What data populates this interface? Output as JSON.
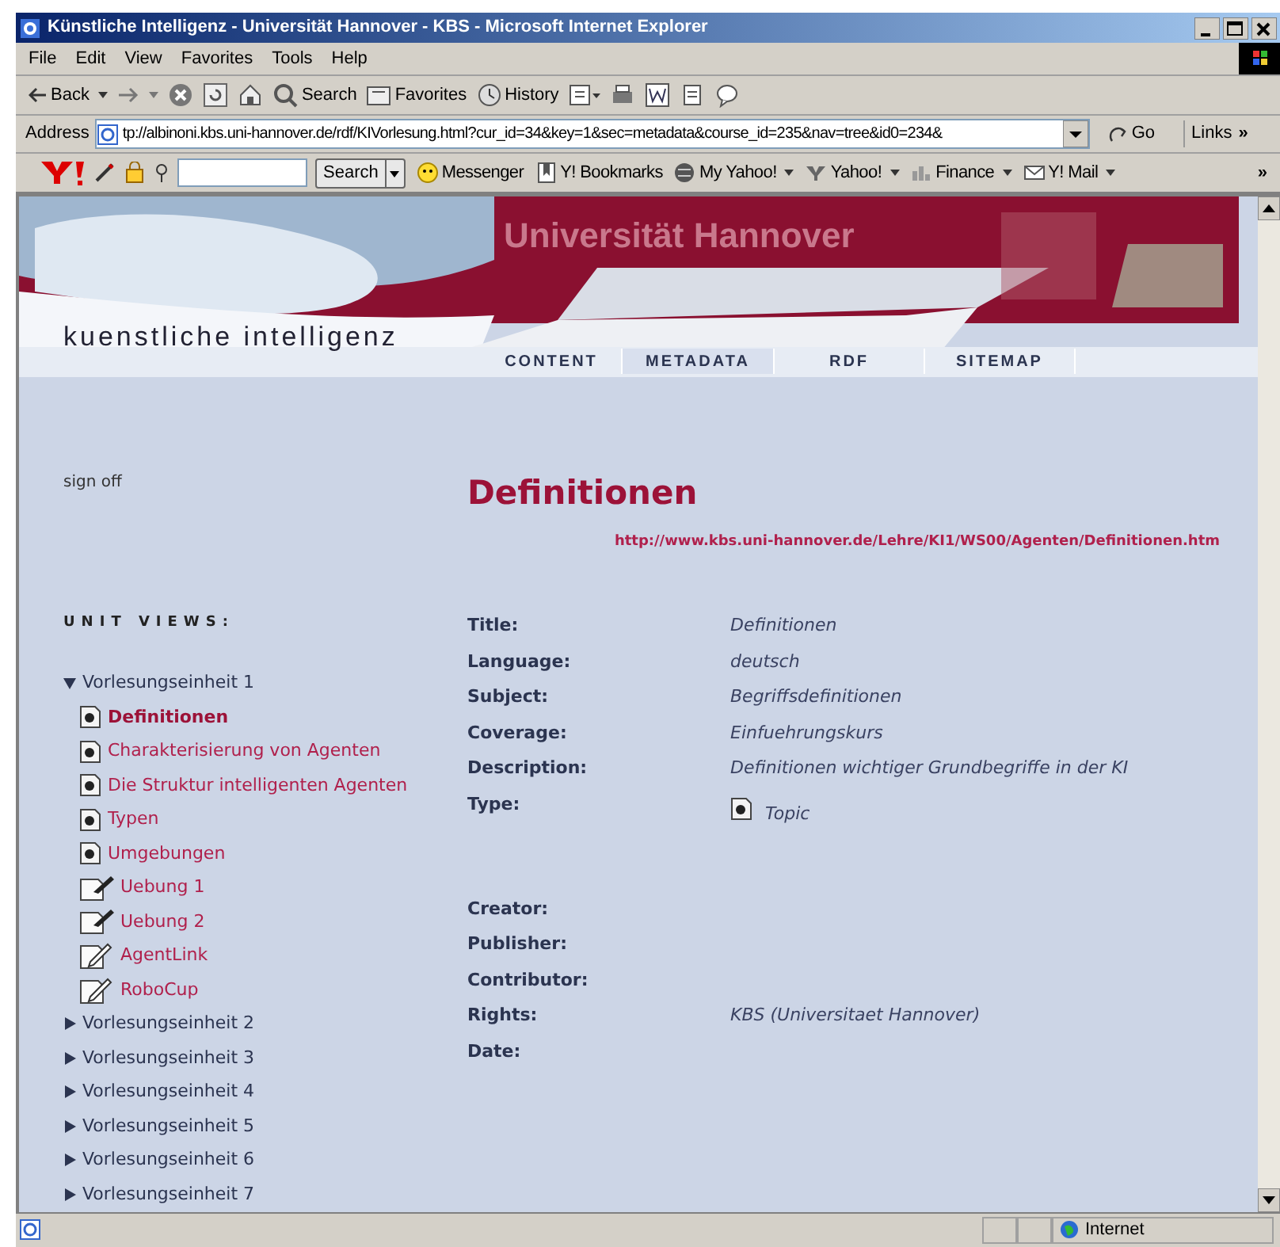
{
  "window": {
    "title": "Künstliche Intelligenz - Universität Hannover - KBS - Microsoft Internet Explorer"
  },
  "menu": [
    "File",
    "Edit",
    "View",
    "Favorites",
    "Tools",
    "Help"
  ],
  "toolbar": {
    "back": "Back",
    "search": "Search",
    "favorites": "Favorites",
    "history": "History"
  },
  "address": {
    "label": "Address",
    "url": "tp://albinoni.kbs.uni-hannover.de/rdf/KIVorlesung.html?cur_id=34&key=1&sec=metadata&course_id=235&nav=tree&id0=234&",
    "go": "Go",
    "links": "Links",
    "links_more": "»"
  },
  "yahoo_bar": {
    "search_button": "Search",
    "items": [
      "Messenger",
      "Y! Bookmarks",
      "My Yahoo!",
      "Yahoo!",
      "Finance",
      "Y! Mail"
    ],
    "more": "»"
  },
  "banner": {
    "university": "Universität Hannover",
    "logo": "kuenstliche intelligenz",
    "nav": [
      {
        "label": "CONTENT",
        "selected": false
      },
      {
        "label": "METADATA",
        "selected": true
      },
      {
        "label": "RDF",
        "selected": false
      },
      {
        "label": "SITEMAP",
        "selected": false
      }
    ]
  },
  "sidebar": {
    "sign_off": "sign off",
    "heading": "UNIT VIEWS:",
    "units": [
      {
        "label": "Vorlesungseinheit 1",
        "expanded": true,
        "children": [
          {
            "label": "Definitionen",
            "kind": "topic",
            "selected": true
          },
          {
            "label": "Charakterisierung von Agenten",
            "kind": "topic",
            "selected": false
          },
          {
            "label": "Die Struktur intelligenten Agenten",
            "kind": "topic",
            "selected": false
          },
          {
            "label": "Typen",
            "kind": "topic",
            "selected": false
          },
          {
            "label": "Umgebungen",
            "kind": "topic",
            "selected": false
          },
          {
            "label": "Uebung 1",
            "kind": "exercise",
            "selected": false
          },
          {
            "label": "Uebung 2",
            "kind": "exercise",
            "selected": false
          },
          {
            "label": "AgentLink",
            "kind": "link",
            "selected": false
          },
          {
            "label": "RoboCup",
            "kind": "link",
            "selected": false
          }
        ]
      },
      {
        "label": "Vorlesungseinheit 2",
        "expanded": false
      },
      {
        "label": "Vorlesungseinheit 3",
        "expanded": false
      },
      {
        "label": "Vorlesungseinheit 4",
        "expanded": false
      },
      {
        "label": "Vorlesungseinheit 5",
        "expanded": false
      },
      {
        "label": "Vorlesungseinheit 6",
        "expanded": false
      },
      {
        "label": "Vorlesungseinheit 7",
        "expanded": false
      }
    ]
  },
  "main": {
    "title": "Definitionen",
    "url": "http://www.kbs.uni-hannover.de/Lehre/KI1/WS00/Agenten/Definitionen.htm",
    "fields": [
      {
        "label": "Title:",
        "value": "Definitionen"
      },
      {
        "label": "Language:",
        "value": "deutsch"
      },
      {
        "label": "Subject:",
        "value": "Begriffsdefinitionen"
      },
      {
        "label": "Coverage:",
        "value": "Einfuehrungskurs"
      },
      {
        "label": "Description:",
        "value": "Definitionen wichtiger Grundbegriffe in der KI"
      },
      {
        "label": "Type:",
        "value": "Topic",
        "kind": "topic"
      },
      {
        "label": "Creator:"
      },
      {
        "label": "Publisher:"
      },
      {
        "label": "Contributor:"
      },
      {
        "label": "Rights:",
        "value": "KBS (Universitaet Hannover)"
      },
      {
        "label": "Date:"
      }
    ]
  },
  "status_bar": {
    "zone": "Internet"
  }
}
